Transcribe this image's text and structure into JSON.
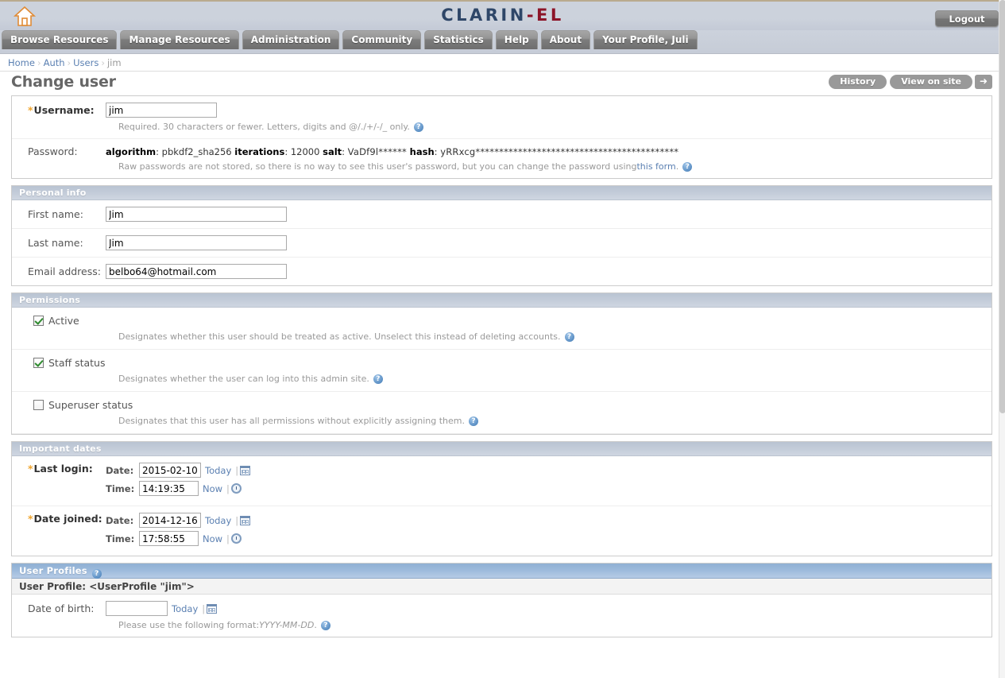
{
  "header": {
    "home_icon": "home-icon",
    "brand_primary": "CLARIN",
    "brand_secondary": "-EL",
    "logout_label": "Logout"
  },
  "nav": {
    "items": [
      {
        "label": "Browse Resources"
      },
      {
        "label": "Manage Resources"
      },
      {
        "label": "Administration"
      },
      {
        "label": "Community"
      },
      {
        "label": "Statistics"
      },
      {
        "label": "Help"
      },
      {
        "label": "About"
      },
      {
        "label": "Your Profile, Juli"
      }
    ]
  },
  "breadcrumb": {
    "items": [
      "Home",
      "Auth",
      "Users"
    ],
    "current": "jim",
    "separator": "›"
  },
  "page": {
    "title": "Change user",
    "history_label": "History",
    "view_on_site_label": "View on site",
    "arrow_glyph": "➜"
  },
  "username_section": {
    "label": "Username:",
    "value": "jim",
    "help": "Required. 30 characters or fewer. Letters, digits and @/./+/-/_ only.",
    "help_icon": "question-mark-icon"
  },
  "password_section": {
    "label": "Password:",
    "algorithm_key": "algorithm",
    "algorithm_value": "pbkdf2_sha256",
    "iterations_key": "iterations",
    "iterations_value": "12000",
    "salt_key": "salt",
    "salt_value": "VaDf9l******",
    "hash_key": "hash",
    "hash_value": "yRRxcg*******************************************",
    "help_prefix": "Raw passwords are not stored, so there is no way to see this user's password, but you can change the password using ",
    "help_link": "this form",
    "help_suffix": "."
  },
  "personal_info": {
    "heading": "Personal info",
    "fields": [
      {
        "label": "First name:",
        "value": "Jim"
      },
      {
        "label": "Last name:",
        "value": "Jim"
      },
      {
        "label": "Email address:",
        "value": "belbo64@hotmail.com"
      }
    ]
  },
  "permissions": {
    "heading": "Permissions",
    "items": [
      {
        "label": "Active",
        "checked": true,
        "help": "Designates whether this user should be treated as active. Unselect this instead of deleting accounts."
      },
      {
        "label": "Staff status",
        "checked": true,
        "help": "Designates whether the user can log into this admin site."
      },
      {
        "label": "Superuser status",
        "checked": false,
        "help": "Designates that this user has all permissions without explicitly assigning them."
      }
    ]
  },
  "important_dates": {
    "heading": "Important dates",
    "date_label": "Date:",
    "time_label": "Time:",
    "today_label": "Today",
    "now_label": "Now",
    "rows": [
      {
        "label": "Last login:",
        "date": "2015-02-10",
        "time": "14:19:35"
      },
      {
        "label": "Date joined:",
        "date": "2014-12-16",
        "time": "17:58:55"
      }
    ]
  },
  "user_profiles": {
    "heading": "User Profiles",
    "inline_title": "User Profile: <UserProfile \"jim\">",
    "dob_label": "Date of birth:",
    "dob_value": "",
    "today_label": "Today",
    "dob_help_prefix": "Please use the following format: ",
    "dob_help_format": "YYYY-MM-DD",
    "dob_help_suffix": "."
  },
  "colors": {
    "brand_blue": "#2e4668",
    "brand_red": "#8c1428",
    "link": "#5b80b2",
    "required_star": "#f0a52e",
    "check_green": "#2e8b2e"
  }
}
